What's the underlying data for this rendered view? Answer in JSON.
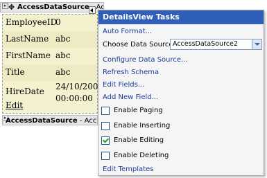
{
  "header": {
    "bold": "AccessDataSource",
    "rest": " - AccessDataSource1"
  },
  "grid": {
    "rows": [
      {
        "label": "EmployeeID",
        "value": "0"
      },
      {
        "label": "LastName",
        "value": "abc"
      },
      {
        "label": "FirstName",
        "value": "abc"
      },
      {
        "label": "Title",
        "value": "abc"
      },
      {
        "label": "HireDate",
        "value_line1": "24/10/2006",
        "value_line2": "00:00:00"
      }
    ],
    "edit_link": "Edit"
  },
  "footer": {
    "bold": "AccessDataSource",
    "rest": " - Access"
  },
  "panel": {
    "title": "DetailsView Tasks",
    "auto_format": "Auto Format...",
    "choose_label": "Choose Data Source:",
    "choose_value": "AccessDataSource2",
    "configure": "Configure Data Source...",
    "refresh": "Refresh Schema",
    "edit_fields": "Edit Fields...",
    "add_field": "Add New Field...",
    "checkboxes": [
      {
        "label": "Enable Paging",
        "checked": false
      },
      {
        "label": "Enable Inserting",
        "checked": false
      },
      {
        "label": "Enable Editing",
        "checked": true
      },
      {
        "label": "Enable Deleting",
        "checked": false
      }
    ],
    "edit_templates": "Edit Templates"
  }
}
